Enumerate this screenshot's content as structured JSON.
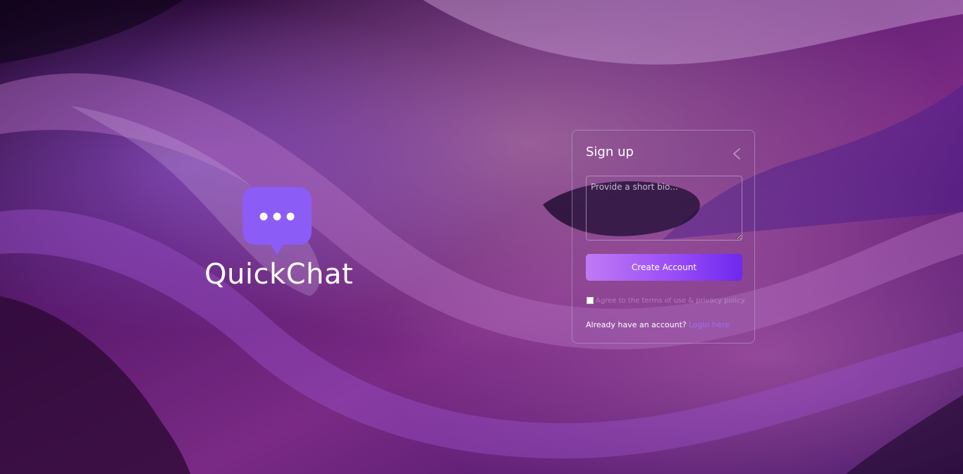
{
  "brand": {
    "name": "QuickChat",
    "logo_icon": "chat-bubble-dots-icon",
    "logo_color": "#8b5cf6"
  },
  "signup": {
    "title": "Sign up",
    "back_icon": "chevron-left-icon",
    "bio_placeholder": "Provide a short bio...",
    "create_button": "Create Account",
    "terms_label": "Agree to the terms of use & privacy policy.",
    "login_prompt": "Already have an account?",
    "login_link": "Login here"
  },
  "theme": {
    "accent": "#8b5cf6",
    "button_gradient_start": "#c07af3",
    "button_gradient_end": "#6d28ee",
    "link": "#9b6cf5"
  }
}
